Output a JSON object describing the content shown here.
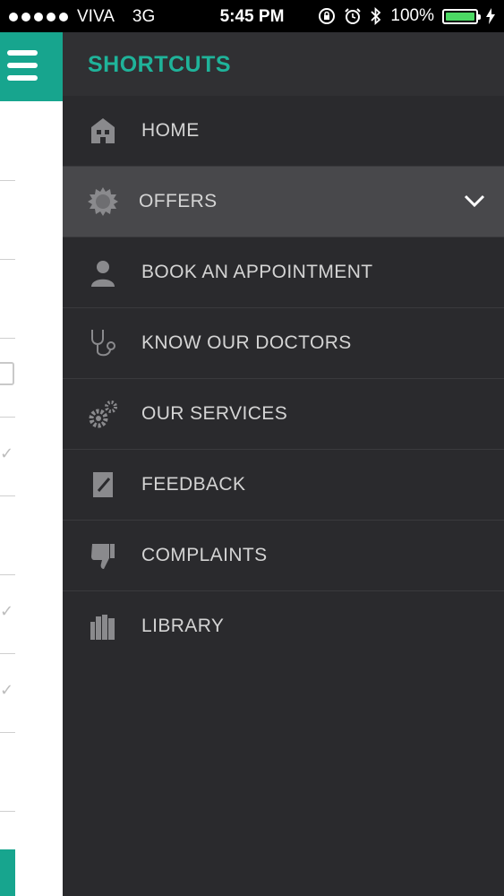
{
  "status": {
    "carrier": "VIVA",
    "network": "3G",
    "time": "5:45 PM",
    "battery": "100%",
    "battery_level": 1.0
  },
  "drawer": {
    "title": "SHORTCUTS",
    "items": [
      {
        "label": "HOME",
        "icon": "home-icon",
        "active": false
      },
      {
        "label": "OFFERS",
        "icon": "offer-badge-icon",
        "active": true,
        "expandable": true
      },
      {
        "label": "BOOK AN APPOINTMENT",
        "icon": "person-icon",
        "active": false
      },
      {
        "label": "KNOW OUR DOCTORS",
        "icon": "stethoscope-icon",
        "active": false
      },
      {
        "label": "OUR SERVICES",
        "icon": "gears-icon",
        "active": false
      },
      {
        "label": "FEEDBACK",
        "icon": "edit-note-icon",
        "active": false
      },
      {
        "label": "COMPLAINTS",
        "icon": "thumbs-down-icon",
        "active": false
      },
      {
        "label": "LIBRARY",
        "icon": "books-icon",
        "active": false
      }
    ]
  },
  "colors": {
    "accent": "#1fb39a",
    "menu_button": "#17a58e",
    "drawer_bg": "#2a2a2d",
    "active_item_bg": "#48484b"
  }
}
